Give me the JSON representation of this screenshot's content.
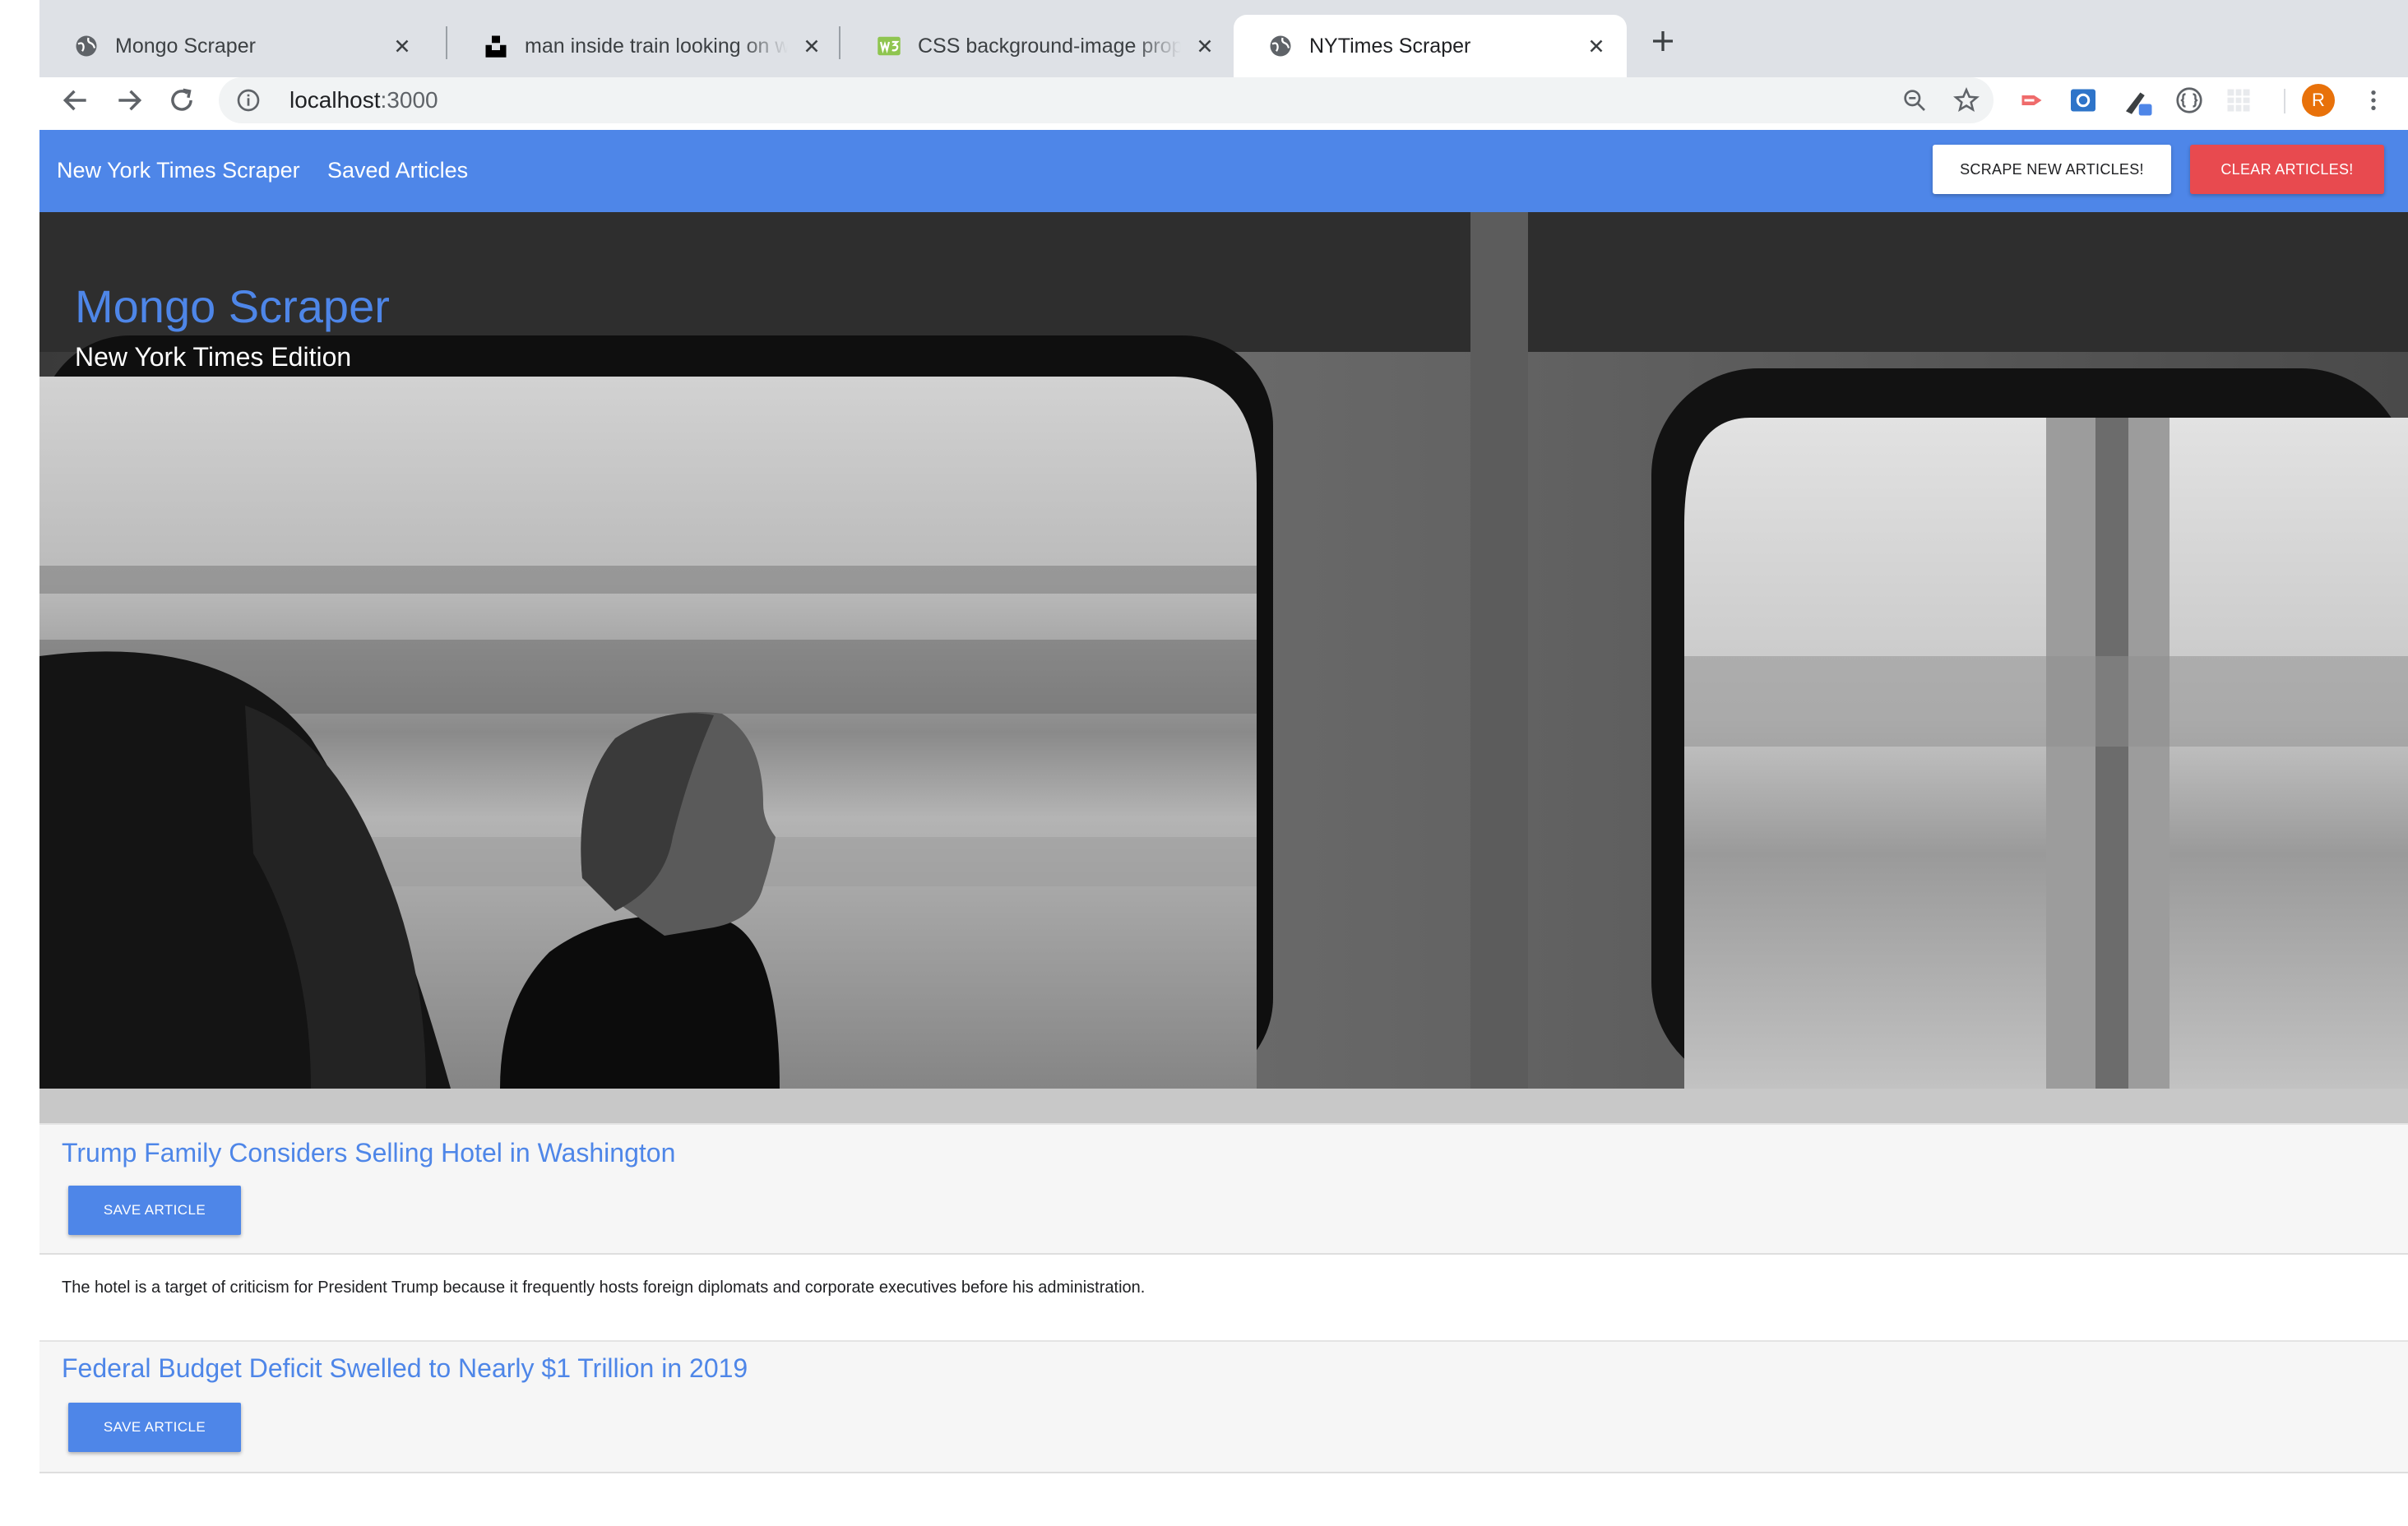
{
  "browser": {
    "tabs": [
      {
        "title": "Mongo Scraper",
        "favicon": "globe-icon",
        "active": false
      },
      {
        "title": "man inside train looking on window",
        "favicon": "unsplash-icon",
        "active": false
      },
      {
        "title": "CSS background-image property",
        "favicon": "w3schools-icon",
        "active": false
      },
      {
        "title": "NYTimes Scraper",
        "favicon": "globe-icon",
        "active": true
      }
    ],
    "url": {
      "host": "localhost",
      "port": ":3000"
    },
    "profile_initial": "R",
    "colors": {
      "tabstrip": "#dee1e6",
      "omnibox": "#f1f3f4",
      "profile": "#e8710a"
    }
  },
  "navbar": {
    "brand": "New York Times Scraper",
    "saved_link": "Saved Articles",
    "scrape_button": "SCRAPE NEW ARTICLES!",
    "clear_button": "CLEAR ARTICLES!",
    "colors": {
      "bar": "#4e86e8",
      "clear": "#e84a4f"
    }
  },
  "hero": {
    "title": "Mongo Scraper",
    "subtitle": "New York Times Edition",
    "background": "grayscale photo of a man inside a train looking out the window"
  },
  "articles": [
    {
      "title": "Trump Family Considers Selling Hotel in Washington",
      "save_label": "SAVE ARTICLE",
      "summary": "The hotel is a target of criticism for President Trump because it frequently hosts foreign diplomats and corporate executives before his administration."
    },
    {
      "title": "Federal Budget Deficit Swelled to Nearly $1 Trillion in 2019",
      "save_label": "SAVE ARTICLE"
    }
  ]
}
